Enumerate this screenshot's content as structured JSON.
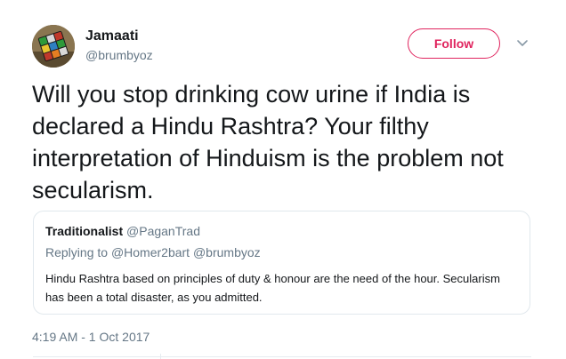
{
  "author": {
    "name": "Jamaati",
    "handle": "@brumbyoz",
    "avatar_icon": "rubiks-cube-photo"
  },
  "follow_button": {
    "label": "Follow",
    "color": "#e0245e"
  },
  "more_menu_icon": "chevron-down-icon",
  "tweet": {
    "text": "Will you stop drinking cow urine if India is declared a Hindu Rashtra? Your filthy interpretation of Hinduism is the problem not secularism."
  },
  "quoted_tweet": {
    "author_name": "Traditionalist",
    "author_handle": "@PaganTrad",
    "replying_prefix": "Replying to",
    "replying_to": "@Homer2bart @brumbyoz",
    "text": "Hindu Rashtra based on principles of duty & honour are the need of the hour. Secularism has been a total disaster, as you admitted."
  },
  "timestamp": "4:19 AM - 1 Oct 2017",
  "colors": {
    "primary_text": "#14171a",
    "secondary_text": "#657786",
    "border": "#e1e8ed"
  }
}
